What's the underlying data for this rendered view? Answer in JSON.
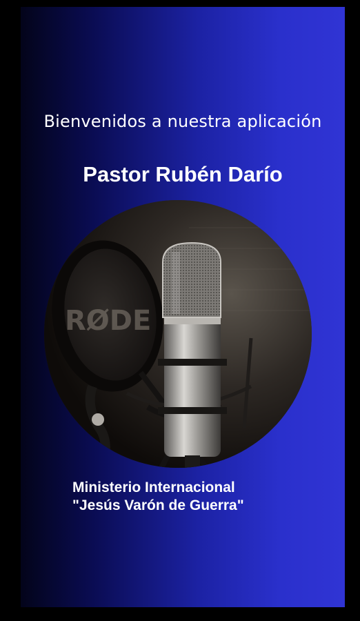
{
  "welcome_text": "Bienvenidos a nuestra aplicación",
  "pastor_name": "Pastor Rubén Darío",
  "image": {
    "subject": "studio microphone with pop filter",
    "brand_text": "RØDE"
  },
  "ministry": {
    "line1": "Ministerio Internacional",
    "line2": "\"Jesús Varón de Guerra\""
  },
  "colors": {
    "background_dark": "#03041a",
    "background_accent": "#2a30cc",
    "text": "#ffffff"
  }
}
